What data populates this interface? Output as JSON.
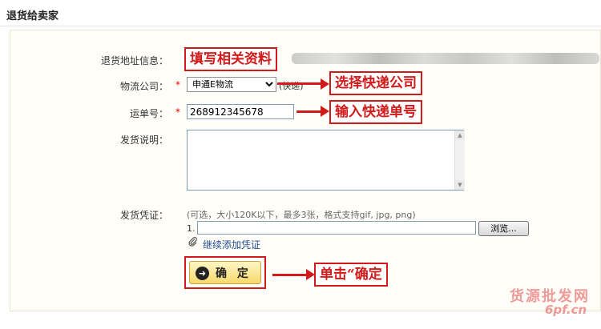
{
  "page": {
    "section_title": "退货给卖家"
  },
  "form": {
    "address_label": "退货地址信息：",
    "logistics_label": "物流公司：",
    "logistics_required": "*",
    "logistics_selected": "申通E物流",
    "logistics_suffix": "(快递)",
    "tracking_label": "运单号：",
    "tracking_required": "*",
    "tracking_value": "268912345678",
    "remark_label": "发货说明：",
    "remark_value": "",
    "voucher_label": "发货凭证：",
    "voucher_hint": "(可选，大小120K以下，最多3张，格式支持gif, jpg, png)",
    "voucher_index": "1.",
    "voucher_file_value": "",
    "browse_label": "浏览...",
    "add_voucher_link": "继续添加凭证",
    "confirm_label": "确 定"
  },
  "annotations": {
    "fill_info": "填写相关资料",
    "choose_courier": "选择快递公司",
    "enter_tracking": "输入快递单号",
    "click_confirm": "单击“确定"
  },
  "watermark": {
    "line1": "货源批发网",
    "line2": "6pf.cn"
  },
  "icons": {
    "confirm": "arrow-right-circle-icon",
    "attach": "paperclip-icon",
    "dropdown": "chevron-down-icon",
    "scroll_up": "triangle-up-icon",
    "scroll_down": "triangle-down-icon"
  },
  "colors": {
    "annotation_red": "#d21a1a",
    "required_star": "#e00000",
    "link_blue": "#1f4a8e",
    "button_yellow": "#f6d96b"
  }
}
